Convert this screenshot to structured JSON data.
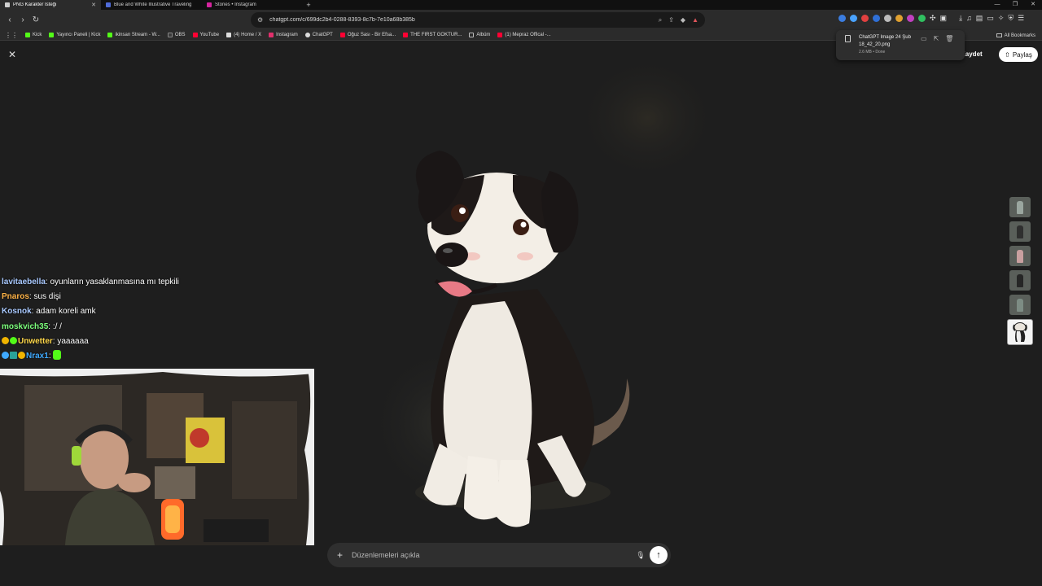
{
  "browser": {
    "tabs": [
      {
        "title": "PNG Karakter İsteği",
        "active": true,
        "favicon_color": "#d0d0d0"
      },
      {
        "title": "Blue and White Illustrative Traveling",
        "active": false,
        "favicon_color": "#4f6bd8"
      },
      {
        "title": "Stories • Instagram",
        "active": false,
        "favicon_color": "#d6249f"
      }
    ],
    "new_tab_label": "+",
    "url": "chatgpt.com/c/699dc2b4-0288-8393-8c7b-7e10a68b385b",
    "bookmarks": [
      {
        "label": "Kick",
        "color": "#53fc18"
      },
      {
        "label": "Yayıncı Paneli | Kick",
        "color": "#53fc18"
      },
      {
        "label": "ikinsan Stream - W...",
        "color": "#53fc18"
      },
      {
        "label": "OBS",
        "color": "#3a3a3a"
      },
      {
        "label": "YouTube",
        "color": "#ff0033"
      },
      {
        "label": "(4) Home / X",
        "color": "#dddddd"
      },
      {
        "label": "Instagram",
        "color": "#e1306c"
      },
      {
        "label": "ChatGPT",
        "color": "#dddddd"
      },
      {
        "label": "Oğuz Sası - Bir Efsa...",
        "color": "#ff0033"
      },
      {
        "label": "THE FIRST GOKTUR...",
        "color": "#ff0033"
      },
      {
        "label": "Albüm",
        "color": "#888888"
      },
      {
        "label": "(1) Mepraz Offical -...",
        "color": "#ff0033"
      }
    ],
    "all_bookmarks_label": "All Bookmarks"
  },
  "download": {
    "file_name": "ChatGPT Image 24 Şub 18_42_20.png",
    "status": "2.6 MB • Done"
  },
  "viewer": {
    "save_label": "Kaydet",
    "share_label": "Paylaş",
    "thumbnail_colors": [
      "#7d8c84",
      "#3a3a3a",
      "#c9a0a0",
      "#2e2e2e",
      "#6d7a72"
    ],
    "prompt_placeholder": "Düzenlemeleri açıkla"
  },
  "chat": [
    {
      "user": "lavitaebella",
      "color": "#a9c9ff",
      "message": "oyunların yasaklanmasına mı tepkili",
      "badges": []
    },
    {
      "user": "Pnaros",
      "color": "#ffb347",
      "message": "sus dişi",
      "badges": []
    },
    {
      "user": "Kosnok",
      "color": "#a9c9ff",
      "message": "adam koreli amk",
      "badges": []
    },
    {
      "user": "moskvich35",
      "color": "#7cff7c",
      "message": ":/ /",
      "badges": []
    },
    {
      "user": "Unwetter",
      "color": "#ffd84a",
      "message": "yaaaaaa",
      "badges": [
        "#f0b400",
        "#53fc18"
      ]
    },
    {
      "user": "Nrax1",
      "color": "#3fa9ff",
      "message": "",
      "badges": [
        "#3fa9ff",
        "#2aa198",
        "#f0b400"
      ]
    }
  ]
}
